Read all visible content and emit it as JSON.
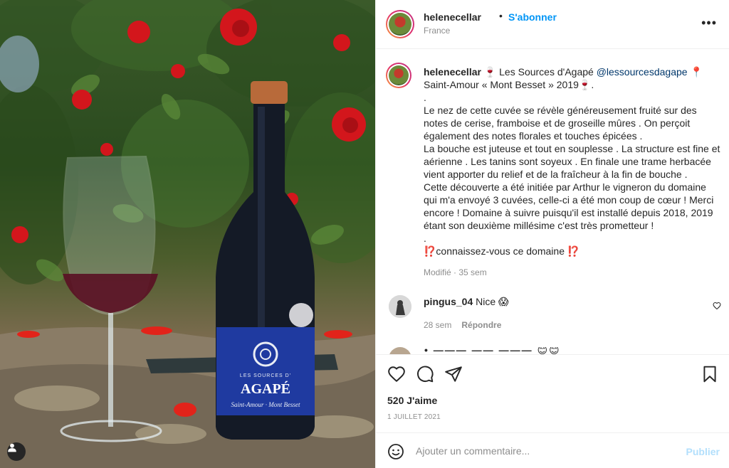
{
  "post": {
    "username": "helenecellar",
    "separator": "•",
    "follow_label": "S'abonner",
    "location": "France",
    "more_label": "•••"
  },
  "caption": {
    "username": "helenecellar",
    "intro": " 🍷 Les Sources d'Agapé ",
    "mention": "@lessourcesdagape",
    "after_mention": " 📍Saint-Amour « Mont Besset » 2019🍷.\n.\nLe nez de cette cuvée se révèle généreusement fruité sur des notes de cerise, framboise et de groseille mûres . On perçoit également des notes florales et touches épicées .\nLa bouche est juteuse et tout en souplesse . La structure est fine et aérienne . Les tanins sont soyeux . En finale une trame herbacée vient apporter du relief et de la fraîcheur à la fin de bouche .\nCette découverte a été initiée par Arthur le vigneron du domaine qui m'a envoyé 3 cuvées, celle-ci a été mon coup de cœur ! Merci encore ! Domaine à suivre puisqu'il est installé depuis 2018, 2019 étant son deuxième millésime c'est très prometteur !\n.\n⁉️connaissez-vous ce domaine ⁉️",
    "meta": "Modifié · 35 sem"
  },
  "comments": [
    {
      "username": "pingus_04",
      "text": " Nice 😱",
      "time": "28 sem",
      "reply_label": "Répondre"
    }
  ],
  "partial_comment": "• ——— —— ——— 😊😊",
  "stats": {
    "likes": "520 J'aime",
    "date": "1 JUILLET 2021"
  },
  "composer": {
    "placeholder": "Ajouter un commentaire...",
    "publish_label": "Publier"
  },
  "photo": {
    "label_brand": "AGAPÉ",
    "label_top": "LES SOURCES D'",
    "label_bottom": "Saint-Amour · Mont Besset"
  },
  "colors": {
    "accent": "#0095f6",
    "publish_disabled": "#b2dffc",
    "muted": "#8e8e8e",
    "text": "#262626",
    "wine_label": "#1f3aa0"
  }
}
